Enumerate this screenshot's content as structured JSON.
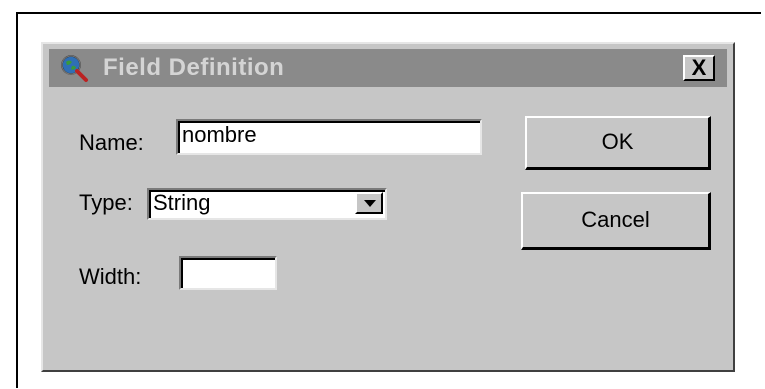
{
  "dialog": {
    "title": "Field Definition",
    "close_label": "X",
    "icon": "search-globe-icon"
  },
  "form": {
    "name_label": "Name:",
    "name_value": "nombre",
    "type_label": "Type:",
    "type_value": "String",
    "width_label": "Width:",
    "width_value": ""
  },
  "buttons": {
    "ok_label": "OK",
    "cancel_label": "Cancel"
  },
  "colors": {
    "dialog_bg": "#c6c6c6",
    "titlebar_inactive": "#8a8a8a"
  }
}
